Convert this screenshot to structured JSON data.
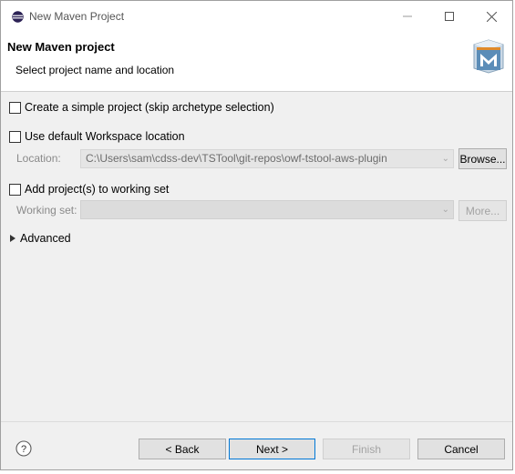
{
  "window": {
    "title": "New Maven Project"
  },
  "banner": {
    "title": "New Maven project",
    "subtitle": "Select project name and location"
  },
  "options": {
    "simple_project_label": "Create a simple project (skip archetype selection)",
    "simple_project_checked": false,
    "default_workspace_label": "Use default Workspace location",
    "default_workspace_checked": false,
    "location_label": "Location:",
    "location_value": "C:\\Users\\sam\\cdss-dev\\TSTool\\git-repos\\owf-tstool-aws-plugin",
    "browse_label": "Browse...",
    "working_set_check_label": "Add project(s) to working set",
    "working_set_checked": false,
    "working_set_label": "Working set:",
    "working_set_value": "",
    "more_label": "More...",
    "advanced_label": "Advanced"
  },
  "footer": {
    "back_label": "< Back",
    "next_label": "Next >",
    "finish_label": "Finish",
    "cancel_label": "Cancel"
  },
  "colors": {
    "accent": "#0078d7",
    "dialog_bg": "#f0f0f0",
    "disabled_text": "#a3a3a3"
  }
}
